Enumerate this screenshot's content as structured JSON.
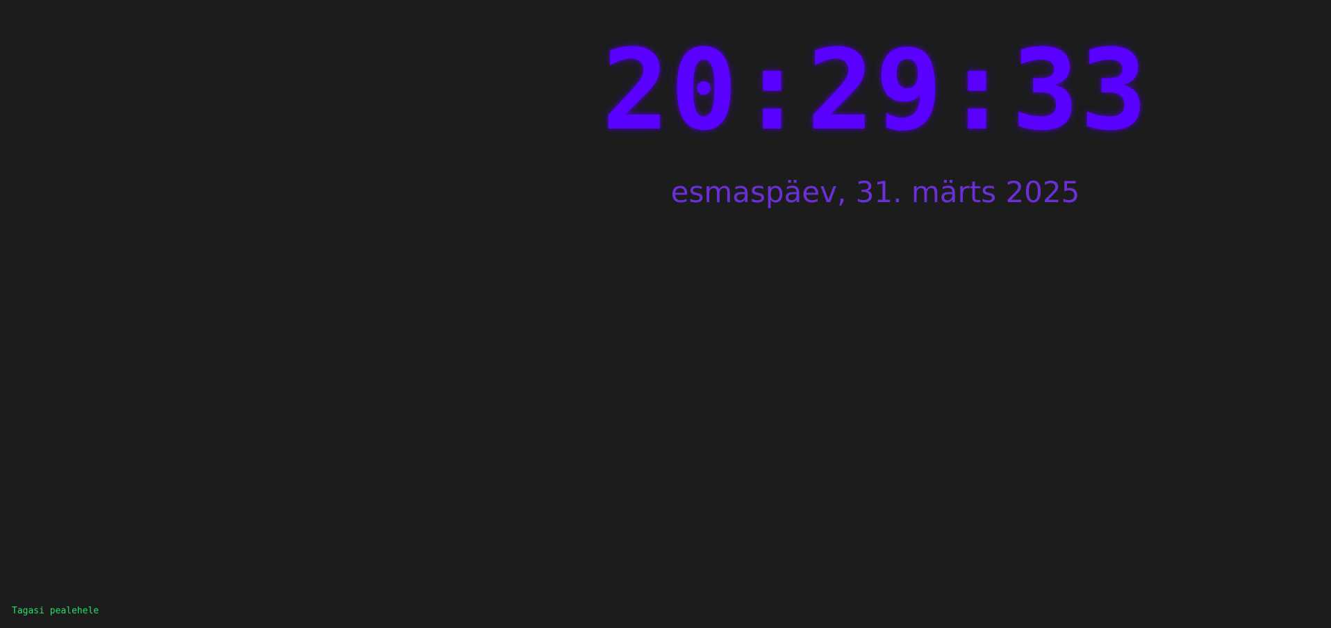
{
  "clock": {
    "time": "20:29:33",
    "date": "esmaspäev, 31. märts 2025"
  },
  "nav": {
    "back_label": "Tagasi pealehele"
  },
  "colors": {
    "background": "#1c1c1c",
    "time": "#5a00ff",
    "date": "#6b2fd6",
    "link": "#22e06b"
  }
}
